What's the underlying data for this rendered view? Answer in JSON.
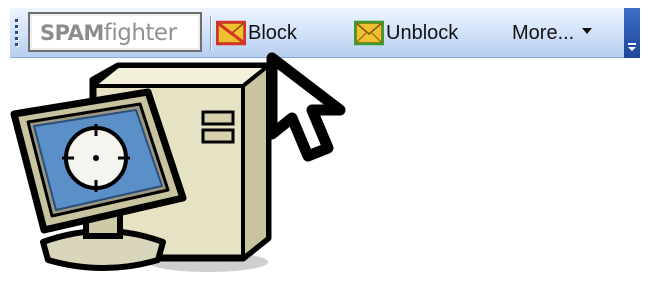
{
  "toolbar": {
    "brand": {
      "prefix": "SPAM",
      "suffix": "fighter",
      "icon": "spamfighter-logo"
    },
    "buttons": [
      {
        "label": "Block",
        "icon": "block-envelope-icon"
      },
      {
        "label": "Unblock",
        "icon": "unblock-envelope-icon"
      },
      {
        "label": "More...",
        "icon": "dropdown-arrow-icon"
      }
    ],
    "overflow_icon": "toolbar-overflow-chevron-icon"
  },
  "illustration": {
    "computer_icon": "desktop-computer-icon",
    "cursor_icon": "mouse-pointer-icon"
  },
  "colors": {
    "toolbar_top": "#eef5ff",
    "toolbar_bottom": "#b7cff0",
    "block_icon_red": "#d8322b",
    "envelope_yellow": "#f0c030",
    "unblock_icon_green": "#3f9a2f",
    "monitor_screen": "#5a8fc8",
    "tower_body": "#e6e2c4"
  }
}
